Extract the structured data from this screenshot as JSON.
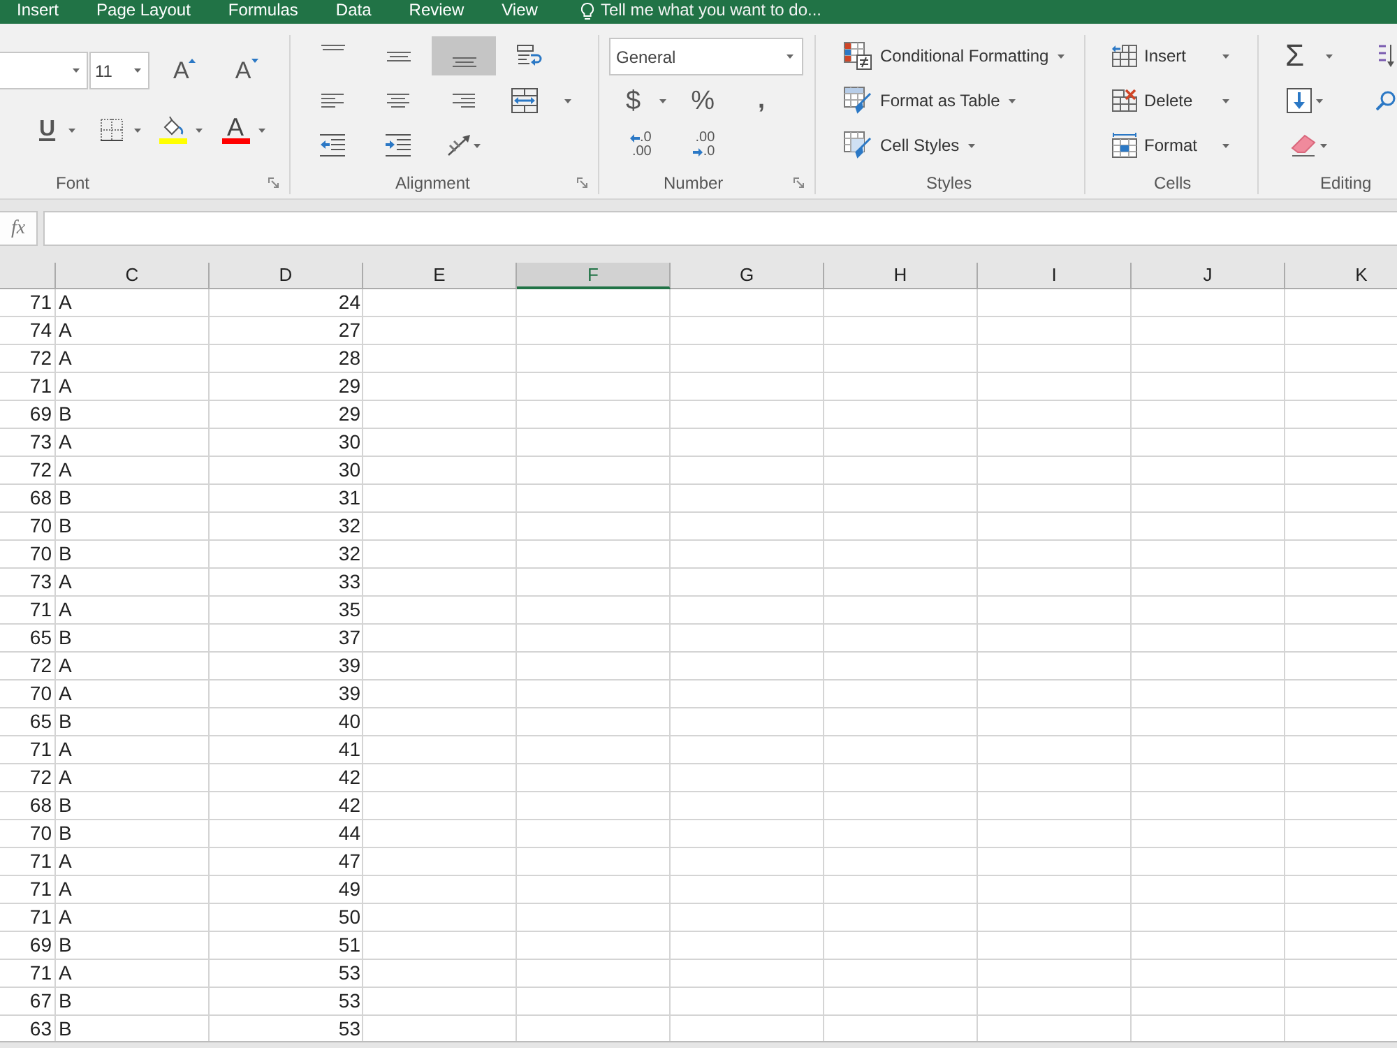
{
  "tabs": [
    {
      "label": "Insert",
      "selected": false
    },
    {
      "label": "Page Layout",
      "selected": false
    },
    {
      "label": "Formulas",
      "selected": false
    },
    {
      "label": "Data",
      "selected": false
    },
    {
      "label": "Review",
      "selected": false
    },
    {
      "label": "View",
      "selected": false
    }
  ],
  "tell_me": {
    "placeholder": "Tell me what you want to do..."
  },
  "ribbon": [
    {
      "kind": "font",
      "label": "Font",
      "font_size": "11",
      "grow_font": "A",
      "shrink_font": "A",
      "underline": "U",
      "font_color": "A"
    },
    {
      "kind": "alignment",
      "label": "Alignment",
      "vertical": [
        {
          "selected": false
        },
        {
          "selected": false
        },
        {
          "selected": true
        }
      ],
      "horizontal": [
        {
          "selected": false
        },
        {
          "selected": false
        },
        {
          "selected": false
        }
      ]
    },
    {
      "kind": "number",
      "label": "Number",
      "format": "General",
      "currency": "$",
      "percent": "%",
      "comma": ",",
      "decrease_decimal": [
        ".0",
        ".00"
      ],
      "increase_decimal": [
        ".00",
        ".0"
      ]
    },
    {
      "kind": "styles",
      "label": "Styles",
      "commands": [
        "Conditional Formatting",
        "Format as Table",
        "Cell Styles"
      ]
    },
    {
      "kind": "cells",
      "label": "Cells",
      "commands": [
        "Insert",
        "Delete",
        "Format"
      ]
    },
    {
      "kind": "editing",
      "label": "Editing",
      "autosum": "Σ"
    }
  ],
  "formula_bar": {
    "function_button": "fx"
  },
  "sheet": {
    "columns": [
      {
        "label": "C",
        "selected": false
      },
      {
        "label": "D",
        "selected": false
      },
      {
        "label": "E",
        "selected": false
      },
      {
        "label": "F",
        "selected": true
      },
      {
        "label": "G",
        "selected": false
      },
      {
        "label": "H",
        "selected": false
      },
      {
        "label": "I",
        "selected": false
      },
      {
        "label": "J",
        "selected": false
      },
      {
        "label": "K",
        "selected": false
      }
    ],
    "rows": [
      [
        "71",
        "A",
        "24"
      ],
      [
        "74",
        "A",
        "27"
      ],
      [
        "72",
        "A",
        "28"
      ],
      [
        "71",
        "A",
        "29"
      ],
      [
        "69",
        "B",
        "29"
      ],
      [
        "73",
        "A",
        "30"
      ],
      [
        "72",
        "A",
        "30"
      ],
      [
        "68",
        "B",
        "31"
      ],
      [
        "70",
        "B",
        "32"
      ],
      [
        "70",
        "B",
        "32"
      ],
      [
        "73",
        "A",
        "33"
      ],
      [
        "71",
        "A",
        "35"
      ],
      [
        "65",
        "B",
        "37"
      ],
      [
        "72",
        "A",
        "39"
      ],
      [
        "70",
        "A",
        "39"
      ],
      [
        "65",
        "B",
        "40"
      ],
      [
        "71",
        "A",
        "41"
      ],
      [
        "72",
        "A",
        "42"
      ],
      [
        "68",
        "B",
        "42"
      ],
      [
        "70",
        "B",
        "44"
      ],
      [
        "71",
        "A",
        "47"
      ],
      [
        "71",
        "A",
        "49"
      ],
      [
        "71",
        "A",
        "50"
      ],
      [
        "69",
        "B",
        "51"
      ],
      [
        "71",
        "A",
        "53"
      ],
      [
        "67",
        "B",
        "53"
      ],
      [
        "63",
        "B",
        "53"
      ]
    ]
  }
}
